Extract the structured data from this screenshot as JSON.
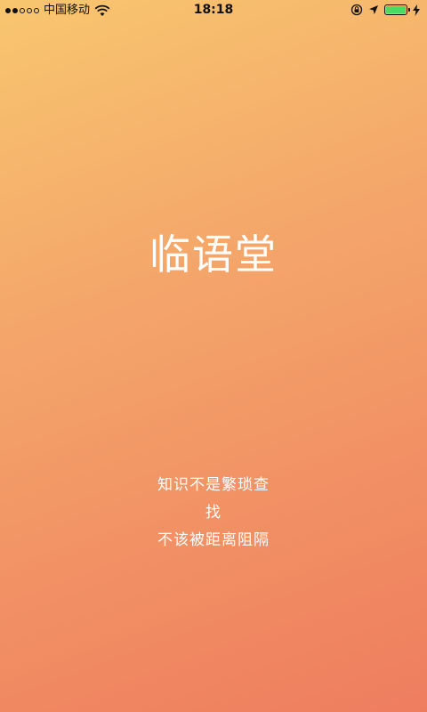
{
  "status_bar": {
    "carrier": "中国移动",
    "time": "18:18",
    "battery_percent": 100,
    "signal_bars": 2,
    "signal_total": 5
  },
  "splash": {
    "title": "临语堂",
    "tagline_lines": [
      "知识不是繁琐查",
      "找",
      "不该被距离阻隔"
    ]
  }
}
